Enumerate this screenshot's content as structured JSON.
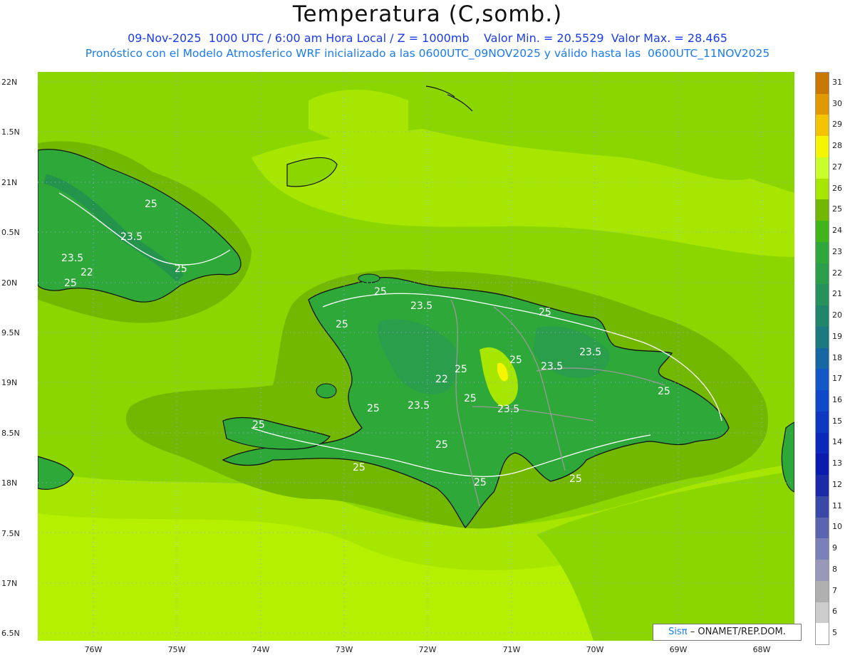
{
  "header": {
    "title": "Temperatura (C,somb.)",
    "subtitle_1": "09-Nov-2025  1000 UTC / 6:00 am Hora Local / Z = 1000mb    Valor Min. = 20.5529  Valor Max. = 28.465",
    "subtitle_2": "Pronóstico con el Modelo Atmosferico WRF inicializado a las 0600UTC_09NOV2025 y válido hasta las  0600UTC_11NOV2025"
  },
  "axes": {
    "y_ticks": [
      "22N",
      "1.5N",
      "21N",
      "0.5N",
      "20N",
      "9.5N",
      "19N",
      "8.5N",
      "18N",
      "7.5N",
      "17N",
      "6.5N"
    ],
    "x_ticks": [
      "76W",
      "75W",
      "74W",
      "73W",
      "72W",
      "71W",
      "70W",
      "69W",
      "68W"
    ]
  },
  "legend": {
    "labels": [
      "31",
      "30",
      "29",
      "28",
      "27",
      "26",
      "25",
      "24",
      "23",
      "22",
      "21",
      "20",
      "19",
      "18",
      "17",
      "16",
      "15",
      "14",
      "13",
      "12",
      "11",
      "10",
      "9",
      "8",
      "7",
      "6",
      "5"
    ],
    "colors": [
      "#c87800",
      "#e09a00",
      "#f5c400",
      "#f5f500",
      "#c8ff28",
      "#a6e600",
      "#73b800",
      "#3fb51a",
      "#2ea83a",
      "#2a9e4a",
      "#24925a",
      "#1f866c",
      "#1a7a80",
      "#1568a4",
      "#1358c8",
      "#1048cc",
      "#0c38c4",
      "#0a28bc",
      "#0a1cb0",
      "#1a2aa8",
      "#3a48a8",
      "#5a64b0",
      "#7a80b8",
      "#9898b8",
      "#b0b0b0",
      "#cccccc",
      "#ffffff"
    ]
  },
  "contour_labels": [
    "25",
    "23.5",
    "23.5",
    "22",
    "25",
    "25",
    "25",
    "23.5",
    "25",
    "25",
    "23.5",
    "23.5",
    "25",
    "22",
    "25",
    "25",
    "23.5",
    "23.5",
    "25",
    "25",
    "25",
    "25",
    "25",
    "25",
    "25"
  ],
  "credit": {
    "sis": "Sisπ",
    "org": "– ONAMET/REP.DOM."
  }
}
